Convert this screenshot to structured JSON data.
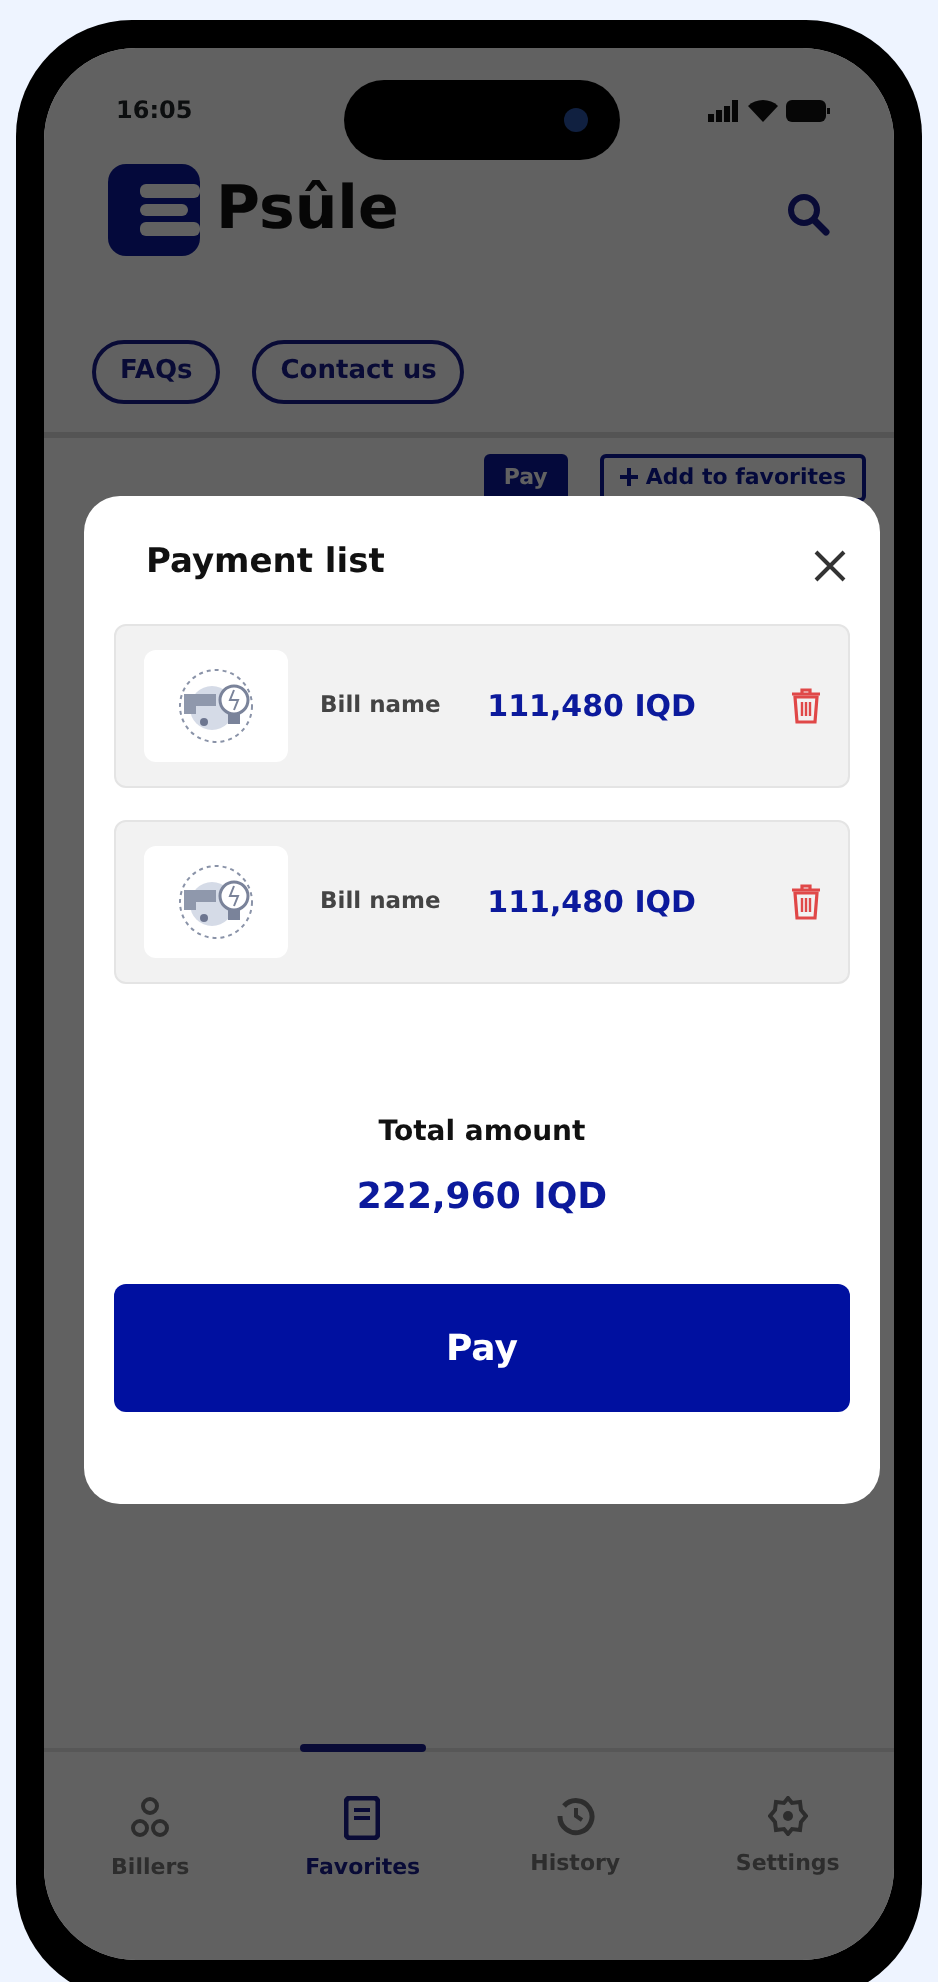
{
  "status_bar": {
    "time": "16:05"
  },
  "header": {
    "brand": "Psûle"
  },
  "links": [
    {
      "label": "FAQs"
    },
    {
      "label": "Contact us"
    }
  ],
  "actions": [
    {
      "label": "Pay",
      "kind": "solid"
    },
    {
      "label": "Add to favorites",
      "kind": "outline"
    }
  ],
  "modal": {
    "title": "Payment list",
    "items": [
      {
        "name": "Bill name",
        "amount": "111,480 IQD"
      },
      {
        "name": "Bill name",
        "amount": "111,480 IQD"
      }
    ],
    "total_label": "Total amount",
    "total": "222,960 IQD",
    "button": "Pay"
  },
  "tab_bar": [
    {
      "label": "Billers",
      "selected": false,
      "kind": "billers"
    },
    {
      "label": "Favorites",
      "selected": true,
      "kind": "favorites"
    },
    {
      "label": "History",
      "selected": false,
      "kind": "history"
    },
    {
      "label": "Settings",
      "selected": false,
      "kind": "settings"
    }
  ]
}
